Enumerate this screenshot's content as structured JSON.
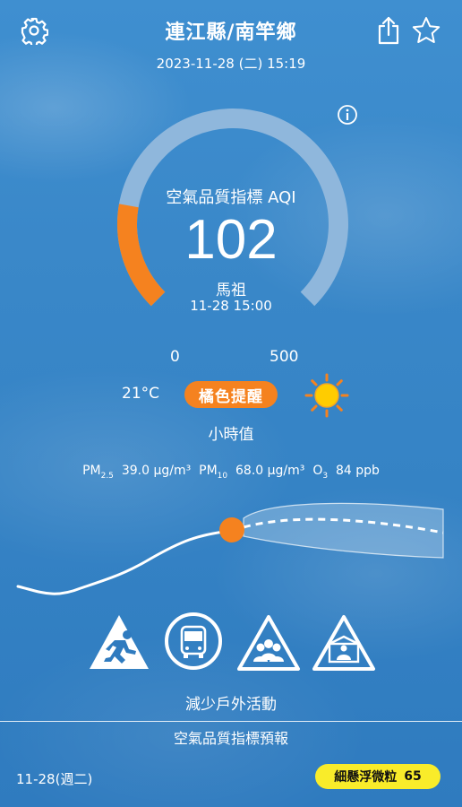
{
  "header": {
    "title": "連江縣/南竿鄉",
    "datetime": "2023-11-28 (二) 15:19"
  },
  "icons": {
    "settings": "gear-icon",
    "share": "share-icon",
    "favorite": "star-icon",
    "info": "info-icon",
    "weather": "sun-icon"
  },
  "gauge": {
    "label": "空氣品質指標 AQI",
    "value": "102",
    "value_fraction": 0.204,
    "station": "馬祖",
    "station_time": "11-28 15:00",
    "scale_min": "0",
    "scale_max": "500"
  },
  "conditions": {
    "temperature": "21°C",
    "alert_label": "橘色提醒",
    "period_label": "小時值"
  },
  "pollutants": {
    "pm25_label": "PM",
    "pm25_sub": "2.5",
    "pm25_value": "39.0 μg/m³",
    "pm10_label": "PM",
    "pm10_sub": "10",
    "pm10_value": "68.0 μg/m³",
    "o3_label": "O",
    "o3_sub": "3",
    "o3_value": "84 ppb"
  },
  "activities": [
    "running-warning-icon",
    "bus-icon",
    "group-warning-icon",
    "indoor-warning-icon"
  ],
  "advice": "減少戶外活動",
  "forecast": {
    "title": "空氣品質指標預報",
    "date": "11-28(週二)",
    "pollutant_label": "細懸浮微粒",
    "pollutant_value": "65"
  },
  "colors": {
    "gauge_fill": "#f5821f",
    "gauge_track": "#8fb7dc",
    "alert": "#f5821f",
    "forecast_badge": "#f9ec2a",
    "sun": "#ffcc00"
  }
}
